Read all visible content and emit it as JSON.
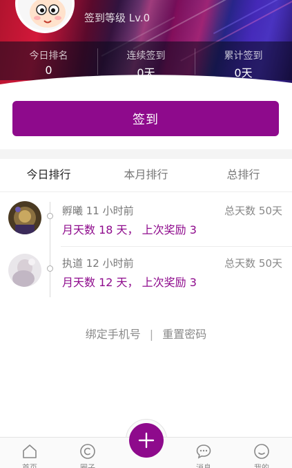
{
  "header": {
    "level_text": "签到等级 Lv.0",
    "stats": [
      {
        "label": "今日排名",
        "value": "0"
      },
      {
        "label": "连续签到",
        "value": "0天"
      },
      {
        "label": "累计签到",
        "value": "0天"
      }
    ]
  },
  "signin_button": {
    "label": "签到"
  },
  "tabs": [
    {
      "label": "今日排行",
      "active": true
    },
    {
      "label": "本月排行",
      "active": false
    },
    {
      "label": "总排行",
      "active": false
    }
  ],
  "rankings": [
    {
      "name_time": "孵曦 11 小时前",
      "total": "总天数 50天",
      "detail": "月天数 18 天， 上次奖励 3",
      "avatar_icon": "user-avatar-icon"
    },
    {
      "name_time": "执道 12 小时前",
      "total": "总天数 50天",
      "detail": "月天数 12 天， 上次奖励 3",
      "avatar_icon": "user-avatar-icon"
    }
  ],
  "footer_links": {
    "bind_phone": "绑定手机号",
    "divider": "|",
    "reset_password": "重置密码"
  },
  "tabbar": {
    "items": [
      {
        "label": "首页",
        "icon": "home-icon"
      },
      {
        "label": "圈子",
        "icon": "circle-icon"
      },
      {
        "label": "发布",
        "icon": "plus-icon"
      },
      {
        "label": "消息",
        "icon": "chat-icon"
      },
      {
        "label": "我的",
        "icon": "smile-icon"
      }
    ]
  },
  "colors": {
    "accent": "#8e0a8c",
    "text_muted": "#888888"
  }
}
